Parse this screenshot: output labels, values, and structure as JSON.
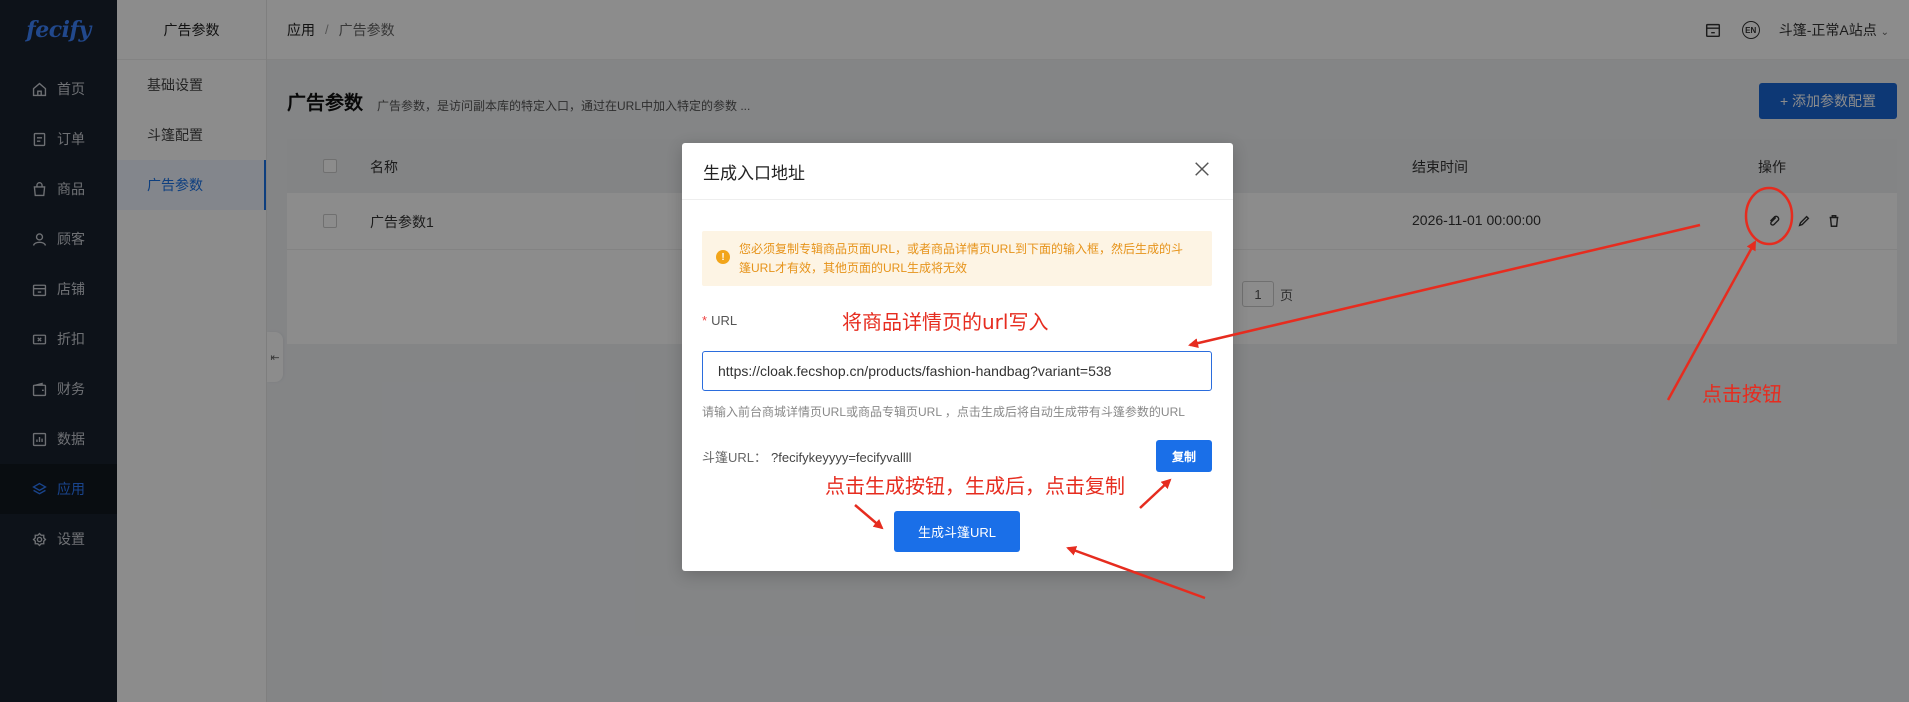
{
  "logo": "fecify",
  "sidebar": {
    "items": [
      {
        "label": "首页",
        "icon": "home-icon"
      },
      {
        "label": "订单",
        "icon": "order-icon"
      },
      {
        "label": "商品",
        "icon": "bag-icon"
      },
      {
        "label": "顾客",
        "icon": "user-icon"
      },
      {
        "label": "店铺",
        "icon": "shop-icon"
      },
      {
        "label": "折扣",
        "icon": "ticket-icon"
      },
      {
        "label": "财务",
        "icon": "wallet-icon"
      },
      {
        "label": "数据",
        "icon": "chart-icon"
      },
      {
        "label": "应用",
        "icon": "cube-icon",
        "active": true
      },
      {
        "label": "设置",
        "icon": "gear-icon"
      }
    ]
  },
  "submenu": {
    "title": "广告参数",
    "items": [
      "基础设置",
      "斗篷配置",
      "广告参数"
    ]
  },
  "header": {
    "breadcrumb_root": "应用",
    "breadcrumb_sep": "/",
    "breadcrumb_current": "广告参数",
    "lang": "EN",
    "site": "斗篷-正常A站点"
  },
  "main": {
    "title": "广告参数",
    "description": "广告参数，是访问副本库的特定入口，通过在URL中加入特定的参数 ...",
    "add_button": "+ 添加参数配置",
    "table": {
      "col_name": "名称",
      "col_end": "结束时间",
      "col_ops": "操作",
      "rows": [
        {
          "name": "广告参数1",
          "end": "2026-11-01 00:00:00"
        }
      ]
    },
    "pager": {
      "page": "1",
      "unit": "页"
    }
  },
  "modal": {
    "title": "生成入口地址",
    "alert": "您必须复制专辑商品页面URL，或者商品详情页URL到下面的输入框，然后生成的斗篷URL才有效，其他页面的URL生成将无效",
    "url_label": "URL",
    "url_required": "*",
    "url_value": "https://cloak.fecshop.cn/products/fashion-handbag?variant=538",
    "url_help": "请输入前台商城详情页URL或商品专辑页URL ，点击生成后将自动生成带有斗篷参数的URL",
    "cloak_label": "斗篷URL：",
    "cloak_value": "?fecifykeyyyy=fecifyvallll",
    "copy_button": "复制",
    "generate_button": "生成斗篷URL"
  },
  "annotations": {
    "write_url": "将商品详情页的url写入",
    "click_generate": "点击生成按钮，生成后，点击复制",
    "click_button": "点击按钮",
    "color": "#e62c1f"
  }
}
